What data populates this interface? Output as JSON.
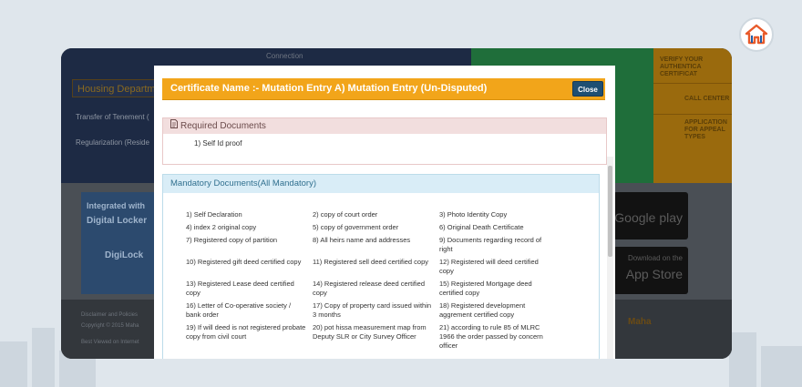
{
  "modal": {
    "title": "Certificate Name :- Mutation Entry A) Mutation Entry (Un-Disputed)",
    "close_label": "Close",
    "required": {
      "heading": "Required Documents",
      "items": [
        "1) Self Id proof"
      ]
    },
    "mandatory": {
      "heading": "Mandatory Documents(All Mandatory)",
      "items": [
        "1) Self Declaration",
        "2) copy of court order",
        "3) Photo Identity Copy",
        "4) index 2 original copy",
        "5) copy of government order",
        "6) Original Death Certificate",
        "7) Registered copy of partition",
        "8) All heirs name and addresses",
        "9) Documents regarding record of right",
        "10) Registered gift deed certified copy",
        "11) Registered sell deed certified copy",
        "12) Registered will deed certified copy",
        "13) Registered Lease deed certified copy",
        "14) Registered release deed certified copy",
        "15) Registered Mortgage deed certified copy",
        "16) Letter of Co-operative society / bank order",
        "17) Copy of property card issued within 3 months",
        "18) Registered development aggrement certified copy",
        "19) If will deed is not registered probate copy from civil court",
        "20) pot hissa measurement map from Deputy SLR or City Survey Officer",
        "21) according to rule 85 of MLRC 1966 the order passed by concern officer"
      ]
    }
  },
  "background": {
    "connection_label": "Connection",
    "housing_label": "Housing Departm",
    "links": [
      "Transfer of Tenement (",
      "Regularization (Reside"
    ],
    "right_panel": [
      [
        "VERIFY YOUR",
        "AUTHENTICA",
        "CERTIFICAT"
      ],
      [
        "CALL CENTER"
      ],
      [
        "APPLICATION",
        "FOR APPEAL",
        "TYPES"
      ]
    ],
    "digilocker": [
      "Integrated with",
      "Digital Locker",
      "DigiLock"
    ],
    "store": [
      "Google play",
      "Download on the",
      "App Store"
    ],
    "footer": [
      "Disclaimer and Policies",
      "Copyright © 2015 Maha",
      "Best Viewed on Internet"
    ],
    "maha_label": "Maha"
  },
  "colors": {
    "modal_header": "#f2a51a",
    "close_button": "#1f4f73",
    "required_header": "#f2dede",
    "mandatory_header": "#d9edf7",
    "logo_accent": "#e85a2a"
  }
}
